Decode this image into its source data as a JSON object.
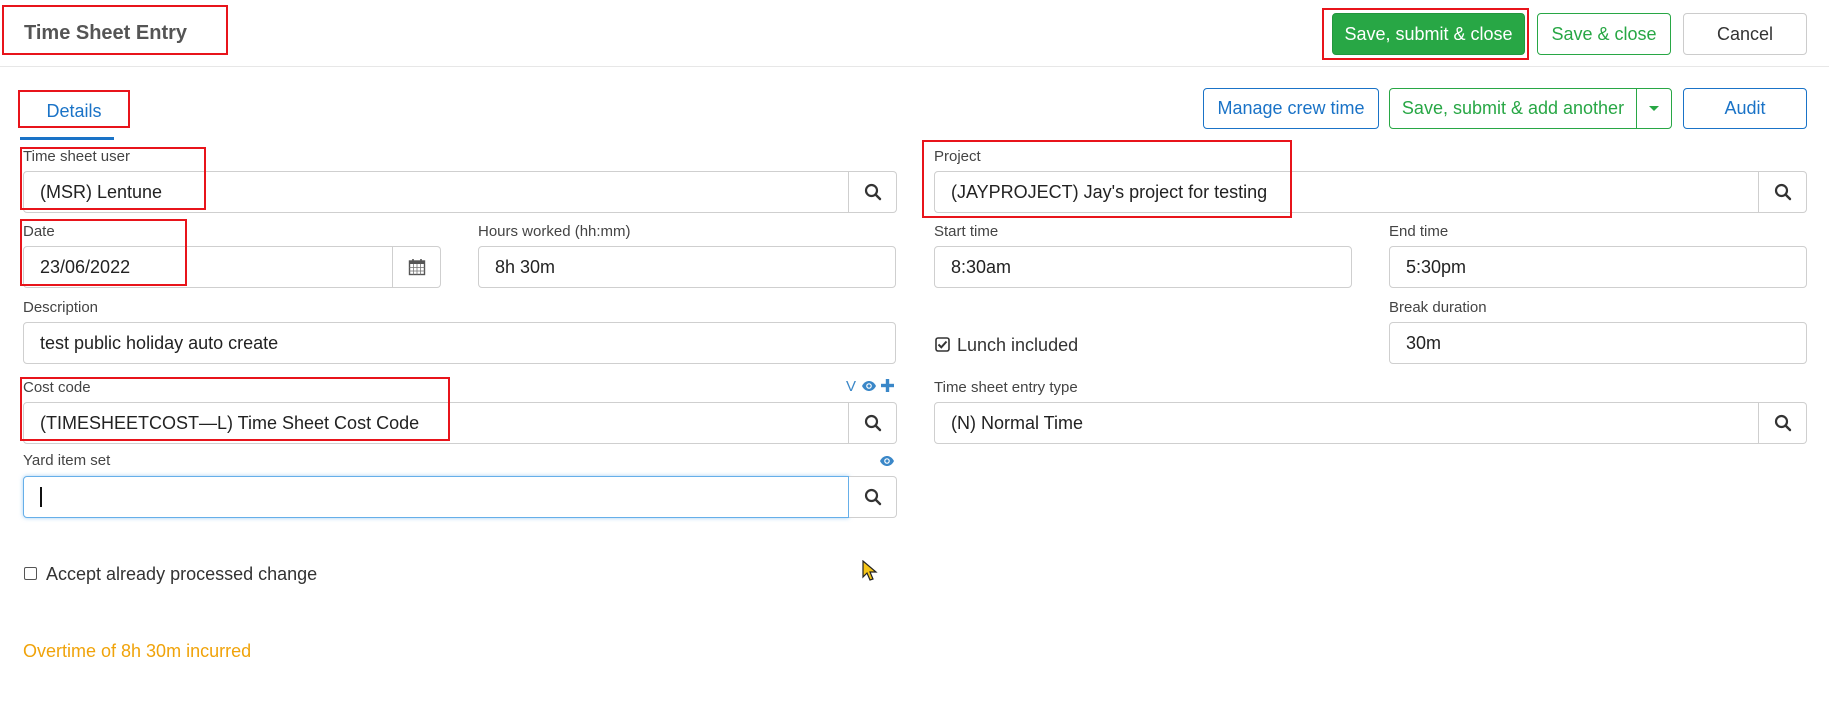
{
  "header": {
    "title": "Time Sheet Entry",
    "save_submit_close": "Save, submit & close",
    "save_close": "Save & close",
    "cancel": "Cancel"
  },
  "tabs": [
    {
      "label": "Details",
      "active": true
    }
  ],
  "toolbar": {
    "manage_crew_time": "Manage crew time",
    "save_submit_add_another": "Save, submit & add another",
    "audit": "Audit"
  },
  "form": {
    "time_sheet_user": {
      "label": "Time sheet user",
      "value": "(MSR) Lentune"
    },
    "project": {
      "label": "Project",
      "value": "(JAYPROJECT) Jay's project for testing"
    },
    "date": {
      "label": "Date",
      "value": "23/06/2022"
    },
    "hours_worked": {
      "label": "Hours worked (hh:mm)",
      "value": "8h 30m"
    },
    "start_time": {
      "label": "Start time",
      "value": "8:30am"
    },
    "end_time": {
      "label": "End time",
      "value": "5:30pm"
    },
    "description": {
      "label": "Description",
      "value": "test public holiday auto create"
    },
    "lunch_included": {
      "label": "Lunch included",
      "checked": true
    },
    "break_duration": {
      "label": "Break duration",
      "value": "30m"
    },
    "cost_code": {
      "label": "Cost code",
      "value": "(TIMESHEETCOST—L) Time Sheet Cost Code",
      "version_tag": "V"
    },
    "entry_type": {
      "label": "Time sheet entry type",
      "value": "(N) Normal Time"
    },
    "yard_item_set": {
      "label": "Yard item set",
      "value": ""
    },
    "accept_processed": {
      "label": "Accept already processed change",
      "checked": false
    }
  },
  "status": {
    "overtime_message": "Overtime of 8h 30m incurred"
  },
  "colors": {
    "primary_green": "#28a745",
    "link_blue": "#1a73c7",
    "warning_orange": "#f0a30a",
    "highlight_red": "#e8141b"
  }
}
